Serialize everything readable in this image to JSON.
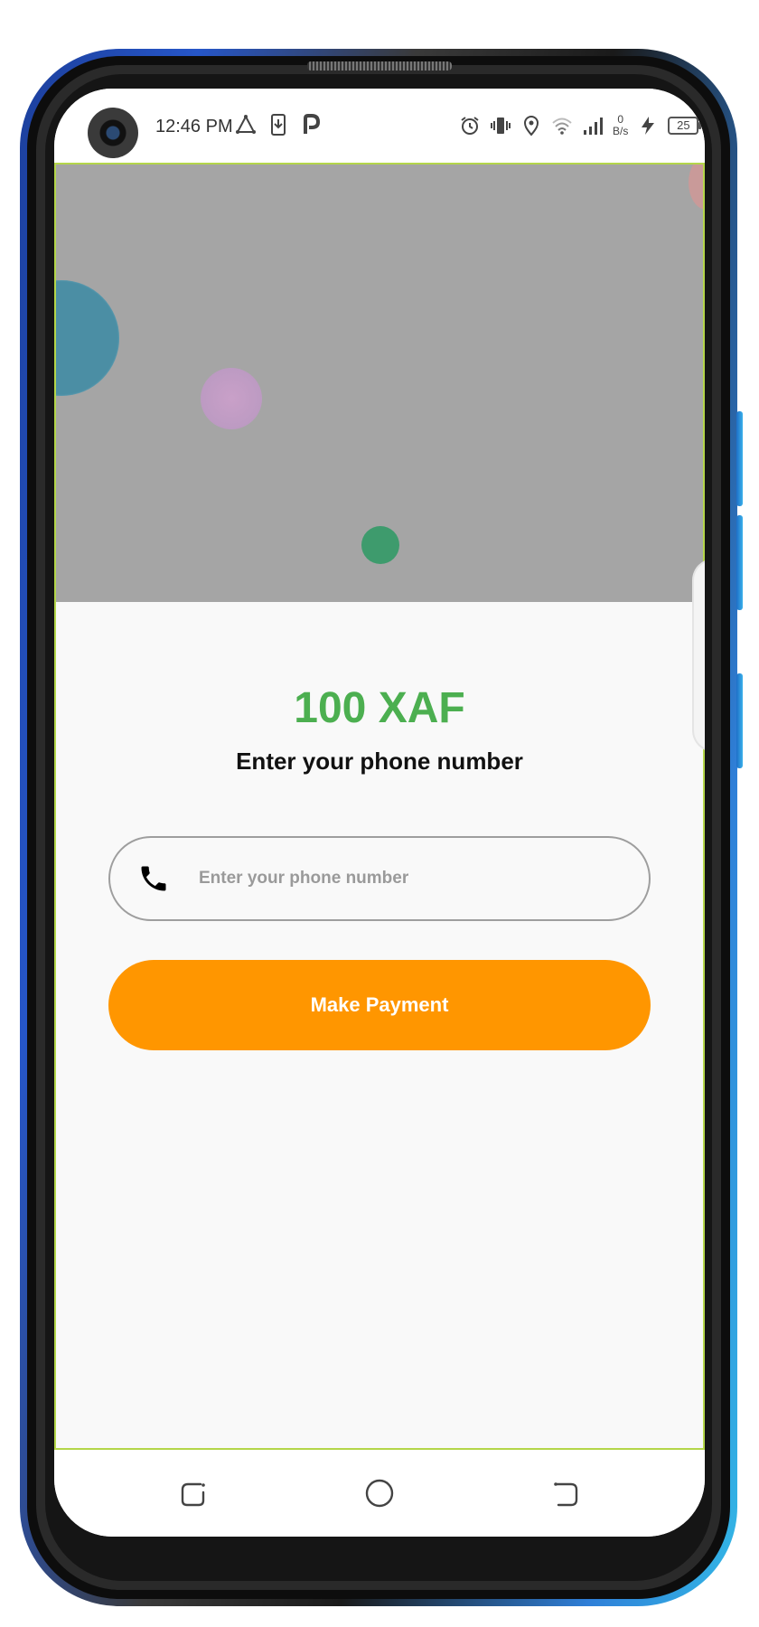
{
  "status_bar": {
    "time": "12:46 PM",
    "left_icons": [
      "triangle-share-icon",
      "phone-download-icon",
      "p-app-icon"
    ],
    "right_icons": [
      "alarm-icon",
      "vibrate-icon",
      "location-icon",
      "wifi-icon",
      "signal-icon"
    ],
    "net_speed_value": "0",
    "net_speed_unit": "B/s",
    "battery_level": "25"
  },
  "payment": {
    "amount": "100 XAF",
    "subtitle": "Enter your phone number",
    "phone_placeholder": "Enter your phone number",
    "phone_value": "",
    "button_label": "Make Payment"
  },
  "colors": {
    "amount": "#4caf50",
    "button": "#ff9600",
    "hero_background": "#a5a5a5",
    "screen_border": "#b4d64a"
  },
  "nav_bar": {
    "buttons": [
      "recent-apps-icon",
      "home-icon",
      "back-icon"
    ]
  }
}
